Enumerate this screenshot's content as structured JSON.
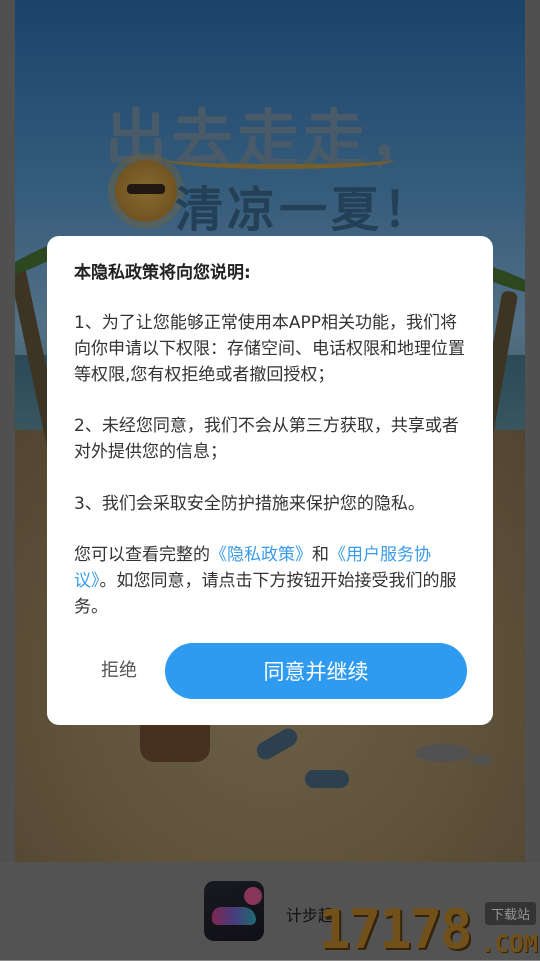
{
  "splash": {
    "headline_line1": "出去走走，",
    "headline_line2": "清凉一夏！"
  },
  "dialog": {
    "title": "本隐私政策将向您说明:",
    "p1": "1、为了让您能够正常使用本APP相关功能，我们将向你申请以下权限：存储空间、电话权限和地理位置等权限,您有权拒绝或者撤回授权；",
    "p2": "2、未经您同意，我们不会从第三方获取，共享或者对外提供您的信息；",
    "p3": "3、我们会采取安全防护措施来保护您的隐私。",
    "p4_prefix": "您可以查看完整的",
    "privacy_link": "《隐私政策》",
    "p4_and": "和",
    "agreement_link": "《用户服务协议》",
    "p4_suffix": "。如您同意，请点击下方按钮开始接受我们的服务。",
    "refuse_label": "拒绝",
    "agree_label": "同意并继续"
  },
  "bottom": {
    "app_name": "计步超",
    "app_icon": "running-shoe-icon"
  },
  "watermark": {
    "number": "17178",
    "tag": "下载站",
    "domain": ".COM"
  },
  "colors": {
    "accent": "#2f9bf0",
    "link": "#3a9bea"
  }
}
